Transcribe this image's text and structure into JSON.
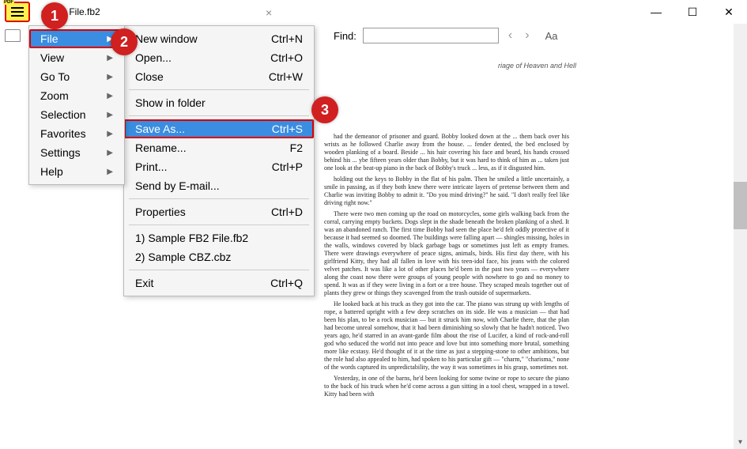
{
  "window": {
    "title": "e FB2 File.fb2",
    "tab_close": "×"
  },
  "toolbar": {
    "find_label": "Find:",
    "find_value": "",
    "prev": "‹",
    "next": "›",
    "font_size": "Aa"
  },
  "menu": {
    "items": [
      {
        "label": "File",
        "has_sub": true,
        "hl": true
      },
      {
        "label": "View",
        "has_sub": true
      },
      {
        "label": "Go To",
        "has_sub": true
      },
      {
        "label": "Zoom",
        "has_sub": true
      },
      {
        "label": "Selection",
        "has_sub": true
      },
      {
        "label": "Favorites",
        "has_sub": true
      },
      {
        "label": "Settings",
        "has_sub": true
      },
      {
        "label": "Help",
        "has_sub": true
      }
    ]
  },
  "submenu": {
    "items": [
      {
        "label": "New window",
        "shortcut": "Ctrl+N"
      },
      {
        "label": "Open...",
        "shortcut": "Ctrl+O"
      },
      {
        "label": "Close",
        "shortcut": "Ctrl+W"
      },
      {
        "label": "Show in folder",
        "shortcut": ""
      },
      {
        "label": "Save As...",
        "shortcut": "Ctrl+S",
        "hl": true
      },
      {
        "label": "Rename...",
        "shortcut": "F2"
      },
      {
        "label": "Print...",
        "shortcut": "Ctrl+P"
      },
      {
        "label": "Send by E-mail...",
        "shortcut": ""
      },
      {
        "label": "Properties",
        "shortcut": "Ctrl+D"
      },
      {
        "label": "1) Sample FB2 File.fb2",
        "shortcut": ""
      },
      {
        "label": "2) Sample CBZ.cbz",
        "shortcut": ""
      },
      {
        "label": "Exit",
        "shortcut": "Ctrl+Q"
      }
    ],
    "separators_after": [
      2,
      3,
      7,
      8,
      10
    ]
  },
  "callouts": {
    "c1": "1",
    "c2": "2",
    "c3": "3"
  },
  "page": {
    "header": "riage of Heaven and Hell",
    "p1": "had the demeanor of prisoner and guard. Bobby looked down at the ... them back over his wrists as he followed Charlie away from the house. ... fender dented, the bed enclosed by wooden planking of a board. Beside ... his hair covering his face and beard, his hands crossed behind his ... ybe fifteen years older than Bobby, but it was hard to think of him as ... taken just one look at the beat-up piano in the back of Bobby's truck ... less, as if it disgusted him.",
    "p2": "holding out the keys to Bobby in the flat of his palm. Then he smiled a little uncertainly, a smile in passing, as if they both knew there were intricate layers of pretense between them and Charlie was inviting Bobby to admit it. \"Do you mind driving?\" he said. \"I don't really feel like driving right now.\"",
    "p3": "There were two men coming up the road on motorcycles, some girls walking back from the corral, carrying empty buckets. Dogs slept in the shade beneath the broken planking of a shed. It was an abandoned ranch. The first time Bobby had seen the place he'd felt oddly protective of it because it had seemed so doomed. The buildings were falling apart — shingles missing, holes in the walls, windows covered by black garbage bags or sometimes just left as empty frames. There were drawings everywhere of peace signs, animals, birds. His first day there, with his girlfriend Kitty, they had all fallen in love with his teen-idol face, his jeans with the colored velvet patches. It was like a lot of other places he'd been in the past two years — everywhere along the coast now there were groups of young people with nowhere to go and no money to spend. It was as if they were living in a fort or a tree house. They scraped meals together out of plants they grew or things they scavenged from the trash outside of supermarkets.",
    "p4": "He looked back at his truck as they got into the car. The piano was strung up with lengths of rope, a battered upright with a few deep scratches on its side. He was a musician — that had been his plan, to be a rock musician — but it struck him now, with Charlie there, that the plan had become unreal somehow, that it had been diminishing so slowly that he hadn't noticed. Two years ago, he'd starred in an avant-garde film about the rise of Lucifer, a kind of rock-and-roll god who seduced the world not into peace and love but into something more brutal, something more like ecstasy. He'd thought of it at the time as just a stepping-stone to other ambitions, but the role had also appealed to him, had spoken to his particular gift — \"charm,\" \"charisma,\" none of the words captured its unpredictability, the way it was sometimes in his grasp, sometimes not.",
    "p5": "Yesterday, in one of the barns, he'd been looking for some twine or rope to secure the piano to the back of his truck when he'd come across a gun sitting in a tool chest, wrapped in a towel. Kitty had been with"
  }
}
